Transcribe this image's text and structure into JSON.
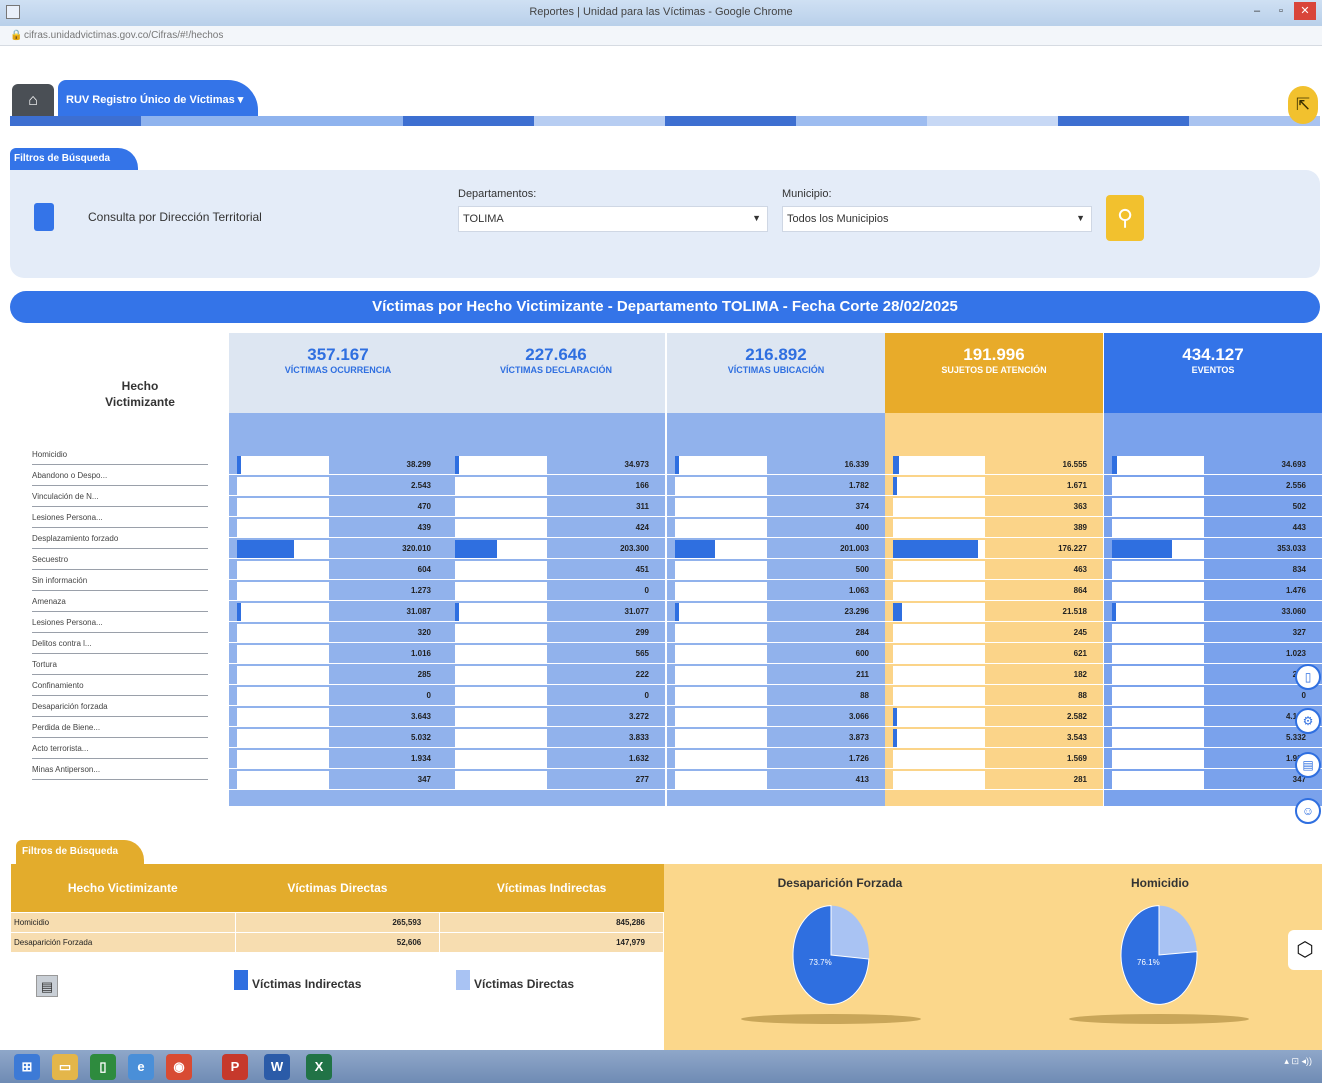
{
  "window": {
    "title": "Reportes | Unidad para las Víctimas - Google Chrome",
    "url": "cifras.unidadvictimas.gov.co/Cifras/#!/hechos"
  },
  "nav": {
    "registry_tab": "RUV Registro Único de Víctimas"
  },
  "filters": {
    "tab_label": "Filtros de Búsqueda",
    "territorial_label": "Consulta por Dirección Territorial",
    "departamentos_label": "Departamentos:",
    "departamentos_value": "TOLIMA",
    "municipio_label": "Municipio:",
    "municipio_value": "Todos los Municipios"
  },
  "banner": "Víctimas por Hecho Victimizante - Departamento TOLIMA - Fecha Corte 28/02/2025",
  "table": {
    "row_header": "Hecho Victimizante",
    "columns": [
      {
        "number": "357.167",
        "label": "VÍCTIMAS OCURRENCIA",
        "bg": "#dde6f2",
        "body": "#91b2ec",
        "num_color": "#2f6fe0",
        "lbl_color": "#2f6fe0"
      },
      {
        "number": "227.646",
        "label": "VÍCTIMAS DECLARACIÓN",
        "bg": "#dde6f2",
        "body": "#91b2ec",
        "num_color": "#2f6fe0",
        "lbl_color": "#2f6fe0"
      },
      {
        "number": "216.892",
        "label": "VÍCTIMAS UBICACIÓN",
        "bg": "#dde6f2",
        "body": "#91b2ec",
        "num_color": "#2f6fe0",
        "lbl_color": "#2f6fe0"
      },
      {
        "number": "191.996",
        "label": "SUJETOS DE ATENCIÓN",
        "bg": "#e8ab2a",
        "body": "#fbd489",
        "num_color": "#ffffff",
        "lbl_color": "#ffffff"
      },
      {
        "number": "434.127",
        "label": "EVENTOS",
        "bg": "#3474e8",
        "body": "#7aa2ec",
        "num_color": "#ffffff",
        "lbl_color": "#ffffff"
      }
    ],
    "rows": [
      {
        "label": "Homicidio",
        "values": [
          "38.299",
          "34.973",
          "16.339",
          "16.555",
          "34.693"
        ],
        "fracs": [
          0.03,
          0.03,
          0.03,
          0.06,
          0.05
        ]
      },
      {
        "label": "Abandono o Despo...",
        "values": [
          "2.543",
          "166",
          "1.782",
          "1.671",
          "2.556"
        ],
        "fracs": [
          0,
          0,
          0,
          0.01,
          0
        ]
      },
      {
        "label": "Vinculación de N...",
        "values": [
          "470",
          "311",
          "374",
          "363",
          "502"
        ],
        "fracs": [
          0,
          0,
          0,
          0,
          0
        ]
      },
      {
        "label": "Lesiones Persona...",
        "values": [
          "439",
          "424",
          "400",
          "389",
          "443"
        ],
        "fracs": [
          0,
          0,
          0,
          0,
          0
        ]
      },
      {
        "label": "Desplazamiento forzado",
        "values": [
          "320.010",
          "203.300",
          "201.003",
          "176.227",
          "353.033"
        ],
        "fracs": [
          0.62,
          0.46,
          0.44,
          0.92,
          0.65
        ]
      },
      {
        "label": "Secuestro",
        "values": [
          "604",
          "451",
          "500",
          "463",
          "834"
        ],
        "fracs": [
          0,
          0,
          0,
          0,
          0
        ]
      },
      {
        "label": "Sin información",
        "values": [
          "1.273",
          "0",
          "1.063",
          "864",
          "1.476"
        ],
        "fracs": [
          0,
          0,
          0,
          0,
          0
        ]
      },
      {
        "label": "Amenaza",
        "values": [
          "31.087",
          "31.077",
          "23.296",
          "21.518",
          "33.060"
        ],
        "fracs": [
          0.03,
          0.03,
          0.03,
          0.1,
          0.03
        ]
      },
      {
        "label": "Lesiones Persona...",
        "values": [
          "320",
          "299",
          "284",
          "245",
          "327"
        ],
        "fracs": [
          0,
          0,
          0,
          0,
          0
        ]
      },
      {
        "label": "Delitos contra l...",
        "values": [
          "1.016",
          "565",
          "600",
          "621",
          "1.023"
        ],
        "fracs": [
          0,
          0,
          0,
          0,
          0
        ]
      },
      {
        "label": "Tortura",
        "values": [
          "285",
          "222",
          "211",
          "182",
          "285"
        ],
        "fracs": [
          0,
          0,
          0,
          0,
          0
        ]
      },
      {
        "label": "Confinamiento",
        "values": [
          "0",
          "0",
          "88",
          "88",
          "0"
        ],
        "fracs": [
          0,
          0,
          0,
          0,
          0
        ]
      },
      {
        "label": "Desaparición forzada",
        "values": [
          "3.643",
          "3.272",
          "3.066",
          "2.582",
          "4.163"
        ],
        "fracs": [
          0,
          0,
          0,
          0.01,
          0
        ]
      },
      {
        "label": "Perdida de Biene...",
        "values": [
          "5.032",
          "3.833",
          "3.873",
          "3.543",
          "5.332"
        ],
        "fracs": [
          0,
          0,
          0,
          0.01,
          0
        ]
      },
      {
        "label": "Acto terrorista...",
        "values": [
          "1.934",
          "1.632",
          "1.726",
          "1.569",
          "1.934"
        ],
        "fracs": [
          0,
          0,
          0,
          0,
          0
        ]
      },
      {
        "label": "Minas Antiperson...",
        "values": [
          "347",
          "277",
          "413",
          "281",
          "347"
        ],
        "fracs": [
          0,
          0,
          0,
          0,
          0
        ]
      }
    ]
  },
  "bottom": {
    "tab_label": "Filtros de Búsqueda",
    "headers": [
      "Hecho Victimizante",
      "Víctimas Directas",
      "Víctimas Indirectas"
    ],
    "rows": [
      {
        "label": "Homicidio",
        "directas": "265,593",
        "indirectas": "845,286"
      },
      {
        "label": "Desaparición Forzada",
        "directas": "52,606",
        "indirectas": "147,979"
      }
    ],
    "legend": [
      {
        "label": "Víctimas Indirectas",
        "color": "#2f6fe0"
      },
      {
        "label": "Víctimas Directas",
        "color": "#a9c3f3"
      }
    ],
    "pies": [
      {
        "title": "Desaparición Forzada",
        "indirect_pct": 73.7,
        "label": "73.7%"
      },
      {
        "title": "Homicidio",
        "indirect_pct": 76.1,
        "label": "76.1%"
      }
    ]
  }
}
